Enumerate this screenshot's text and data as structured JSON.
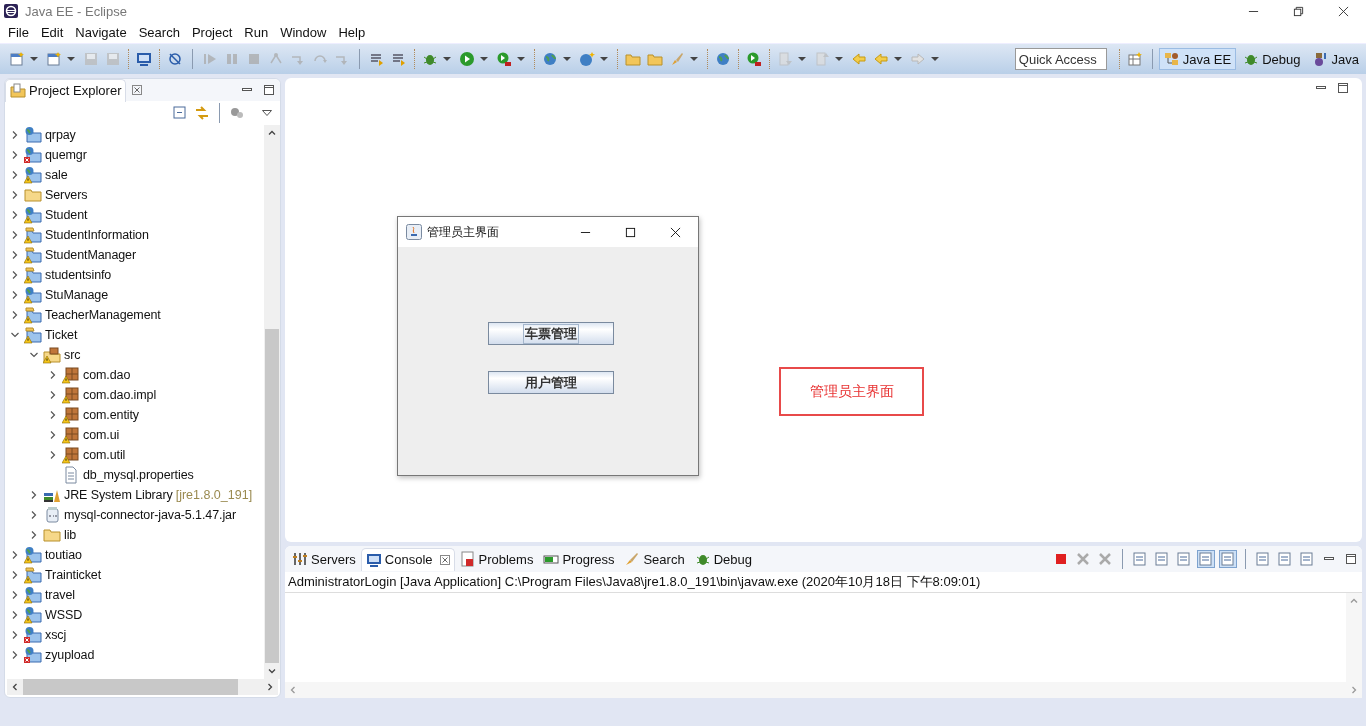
{
  "window": {
    "title": "Java EE - Eclipse"
  },
  "menu": [
    "File",
    "Edit",
    "Navigate",
    "Search",
    "Project",
    "Run",
    "Window",
    "Help"
  ],
  "quick_access": {
    "placeholder": "Quick Access"
  },
  "perspectives": [
    {
      "kind": "javaee",
      "label": "Java EE",
      "selected": true
    },
    {
      "kind": "debug",
      "label": "Debug",
      "selected": false
    },
    {
      "kind": "java",
      "label": "Java",
      "selected": false
    }
  ],
  "project_explorer": {
    "title": "Project Explorer",
    "tree": [
      {
        "kind": "web-project",
        "label": "qrpay",
        "warning": false,
        "error": false,
        "expanded": false
      },
      {
        "kind": "web-project",
        "label": "quemgr",
        "warning": false,
        "error": true,
        "expanded": false
      },
      {
        "kind": "web-project",
        "label": "sale",
        "warning": true,
        "error": false,
        "expanded": false
      },
      {
        "kind": "folder",
        "label": "Servers",
        "warning": false,
        "error": false,
        "expanded": false
      },
      {
        "kind": "web-project",
        "label": "Student",
        "warning": true,
        "error": false,
        "expanded": false
      },
      {
        "kind": "project",
        "label": "StudentInformation",
        "warning": true,
        "error": false,
        "expanded": false
      },
      {
        "kind": "project",
        "label": "StudentManager",
        "warning": true,
        "error": false,
        "expanded": false
      },
      {
        "kind": "project",
        "label": "studentsinfo",
        "warning": true,
        "error": false,
        "expanded": false
      },
      {
        "kind": "web-project",
        "label": "StuManage",
        "warning": true,
        "error": false,
        "expanded": false
      },
      {
        "kind": "project",
        "label": "TeacherManagement",
        "warning": true,
        "error": false,
        "expanded": false
      },
      {
        "kind": "project",
        "label": "Ticket",
        "warning": true,
        "error": false,
        "expanded": true,
        "children": [
          {
            "kind": "source-folder",
            "label": "src",
            "warning": true,
            "error": false,
            "expanded": true,
            "children": [
              {
                "kind": "package",
                "label": "com.dao",
                "warning": true,
                "error": false,
                "expanded": false
              },
              {
                "kind": "package",
                "label": "com.dao.impl",
                "warning": true,
                "error": false,
                "expanded": false
              },
              {
                "kind": "package",
                "label": "com.entity",
                "warning": true,
                "error": false,
                "expanded": false
              },
              {
                "kind": "package",
                "label": "com.ui",
                "warning": true,
                "error": false,
                "expanded": false
              },
              {
                "kind": "package",
                "label": "com.util",
                "warning": true,
                "error": false,
                "expanded": false
              },
              {
                "kind": "file",
                "label": "db_mysql.properties",
                "warning": false,
                "error": false
              }
            ]
          },
          {
            "kind": "library",
            "label": "JRE System Library",
            "suffix": "[jre1.8.0_191]",
            "warning": false,
            "error": false,
            "expanded": false
          },
          {
            "kind": "jar",
            "label": "mysql-connector-java-5.1.47.jar",
            "warning": false,
            "error": false,
            "expanded": false
          },
          {
            "kind": "folder",
            "label": "lib",
            "warning": false,
            "error": false,
            "expanded": false
          }
        ]
      },
      {
        "kind": "web-project",
        "label": "toutiao",
        "warning": true,
        "error": false,
        "expanded": false
      },
      {
        "kind": "project",
        "label": "Trainticket",
        "warning": true,
        "error": false,
        "expanded": false
      },
      {
        "kind": "web-project",
        "label": "travel",
        "warning": true,
        "error": false,
        "expanded": false
      },
      {
        "kind": "web-project",
        "label": "WSSD",
        "warning": true,
        "error": false,
        "expanded": false
      },
      {
        "kind": "web-project",
        "label": "xscj",
        "warning": false,
        "error": true,
        "expanded": false
      },
      {
        "kind": "web-project",
        "label": "zyupload",
        "warning": false,
        "error": true,
        "expanded": false
      }
    ]
  },
  "dialog": {
    "title": "管理员主界面",
    "buttons": [
      {
        "label": "车票管理",
        "focused": true
      },
      {
        "label": "用户管理",
        "focused": false
      }
    ]
  },
  "annotation": {
    "text": "管理员主界面"
  },
  "console": {
    "tabs": [
      {
        "kind": "servers",
        "label": "Servers",
        "selected": false
      },
      {
        "kind": "console",
        "label": "Console",
        "selected": true
      },
      {
        "kind": "problems",
        "label": "Problems",
        "selected": false
      },
      {
        "kind": "progress",
        "label": "Progress",
        "selected": false
      },
      {
        "kind": "search",
        "label": "Search",
        "selected": false
      },
      {
        "kind": "debug",
        "label": "Debug",
        "selected": false
      }
    ],
    "launch": "AdministratorLogin [Java Application] C:\\Program Files\\Java8\\jre1.8.0_191\\bin\\javaw.exe (2020年10月18日 下午8:09:01)"
  }
}
